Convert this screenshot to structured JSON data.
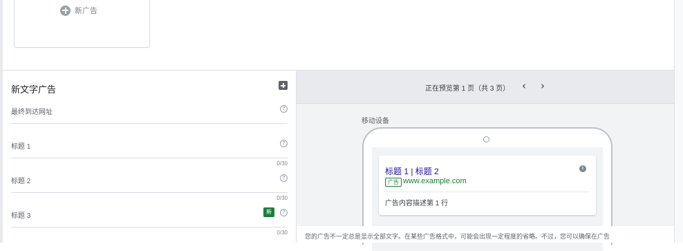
{
  "new_ad": {
    "label": "新广告"
  },
  "form": {
    "title": "新文字广告",
    "fields": [
      {
        "label": "最终到达网址"
      },
      {
        "label": "标题 1",
        "counter": "0/30"
      },
      {
        "label": "标题 2",
        "counter": "0/30"
      },
      {
        "label": "标题 3",
        "counter": "0/30",
        "badge": "新"
      }
    ]
  },
  "preview": {
    "status": "正在预览第 1 页（共 3 页）",
    "prev_icon": "‹",
    "next_icon": "›",
    "device_label": "移动设备",
    "ad": {
      "headline": "标题 1 | 标题 2",
      "badge": "广告",
      "url": "www.example.com",
      "description": "广告内容描述第 1 行"
    },
    "disclaimer": "您的广告不一定总是显示全部文字。在某些广告格式中，可能会出现一定程度的省略。不过，您可以确保在广告"
  },
  "colors": {
    "link": "#1a0dab",
    "url_green": "#188038",
    "badge_green": "#188038"
  }
}
